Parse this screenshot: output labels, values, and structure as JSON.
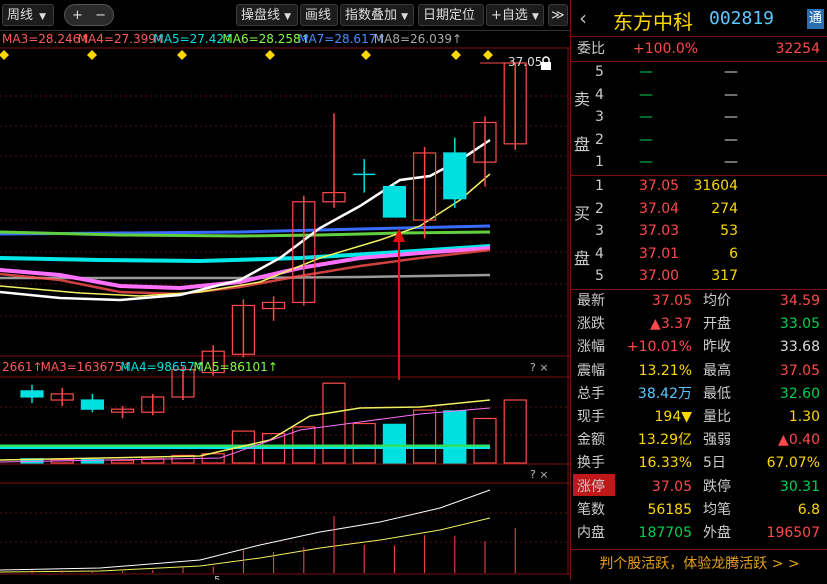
{
  "toolbar": {
    "period": "周线",
    "plus": "+",
    "minus": "−",
    "chart_mode": "操盘线",
    "draw": "画线",
    "index_overlay": "指数叠加",
    "date_locate": "日期定位",
    "watchlist": "+自选",
    "next": "≫"
  },
  "ma_legend": [
    {
      "text": "MA3=28.246↑",
      "color": "#ff5a5a"
    },
    {
      "text": "MA4=27.399↑",
      "color": "#ff5a5a"
    },
    {
      "text": "MA5=27.42↑",
      "color": "#00e0e0"
    },
    {
      "text": "MA6=28.258↑",
      "color": "#80ff40"
    },
    {
      "text": "MA7=28.617↑",
      "color": "#4a8cff"
    },
    {
      "text": "MA8=26.039↑",
      "color": "#aaaaaa"
    }
  ],
  "price_label": "37.05",
  "vol_legend": [
    {
      "text": "2661↑",
      "color": "#ff5a5a"
    },
    {
      "text": "MA3=163675↑",
      "color": "#ff5a5a"
    },
    {
      "text": "MA4=98657↑",
      "color": "#00e0e0"
    },
    {
      "text": "MA5=86101↑",
      "color": "#80ff40"
    }
  ],
  "panel_icons": "? ×",
  "x_tick": "5",
  "quote": {
    "name": "东方中科",
    "code": "002819",
    "tong": "通",
    "back": "‹",
    "weibi_label": "委比",
    "weibi_value": "+100.0%",
    "weibi_count": "32254",
    "sell_label_1": "卖",
    "sell_label_2": "盘",
    "buy_label_1": "买",
    "buy_label_2": "盘",
    "sells": [
      {
        "level": "5",
        "price": "—",
        "vol": "—"
      },
      {
        "level": "4",
        "price": "—",
        "vol": "—"
      },
      {
        "level": "3",
        "price": "—",
        "vol": "—"
      },
      {
        "level": "2",
        "price": "—",
        "vol": "—"
      },
      {
        "level": "1",
        "price": "—",
        "vol": "—"
      }
    ],
    "buys": [
      {
        "level": "1",
        "price": "37.05",
        "vol": "31604"
      },
      {
        "level": "2",
        "price": "37.04",
        "vol": "274"
      },
      {
        "level": "3",
        "price": "37.03",
        "vol": "53"
      },
      {
        "level": "4",
        "price": "37.01",
        "vol": "6"
      },
      {
        "level": "5",
        "price": "37.00",
        "vol": "317"
      }
    ],
    "stats": [
      {
        "l1": "最新",
        "v1": "37.05",
        "c1": "red",
        "l2": "均价",
        "v2": "34.59",
        "c2": "red"
      },
      {
        "l1": "涨跌",
        "v1": "▲3.37",
        "c1": "red",
        "l2": "开盘",
        "v2": "33.05",
        "c2": "green"
      },
      {
        "l1": "涨幅",
        "v1": "+10.01%",
        "c1": "red",
        "l2": "昨收",
        "v2": "33.68",
        "c2": "white"
      },
      {
        "l1": "震幅",
        "v1": "13.21%",
        "c1": "yellow",
        "l2": "最高",
        "v2": "37.05",
        "c2": "red"
      },
      {
        "l1": "总手",
        "v1": "38.42万",
        "c1": "cyan",
        "l2": "最低",
        "v2": "32.60",
        "c2": "green"
      },
      {
        "l1": "现手",
        "v1": "194▼",
        "c1": "yellow",
        "l2": "量比",
        "v2": "1.30",
        "c2": "yellow"
      },
      {
        "l1": "金额",
        "v1": "13.29亿",
        "c1": "yellow",
        "l2": "强弱",
        "v2": "▲0.40",
        "c2": "red"
      },
      {
        "l1": "换手",
        "v1": "16.33%",
        "c1": "yellow",
        "l2": "5日",
        "v2": "67.07%",
        "c2": "yellow"
      },
      {
        "l1": "涨停",
        "v1": "37.05",
        "c1": "red",
        "l2": "跌停",
        "v2": "30.31",
        "c2": "green"
      },
      {
        "l1": "笔数",
        "v1": "56185",
        "c1": "yellow",
        "l2": "均笔",
        "v2": "6.8",
        "c2": "yellow"
      },
      {
        "l1": "内盘",
        "v1": "187705",
        "c1": "green",
        "l2": "外盘",
        "v2": "196507",
        "c2": "red"
      }
    ],
    "promo": "判个股活跃，体验龙腾活跃 > >"
  },
  "colors": {
    "up": "#ff4a4a",
    "down": "#00e0e0",
    "grid": "#7a1010",
    "arrow": "#e01010"
  },
  "chart_data": {
    "type": "candlestick",
    "timeframe": "weekly",
    "y_axis_ticks_visible": [
      "37.05"
    ],
    "candles": [
      {
        "o": 26.3,
        "h": 26.5,
        "l": 25.9,
        "c": 26.1,
        "dir": "down"
      },
      {
        "o": 26.0,
        "h": 26.4,
        "l": 25.8,
        "c": 26.2,
        "dir": "up"
      },
      {
        "o": 26.0,
        "h": 26.2,
        "l": 25.6,
        "c": 25.7,
        "dir": "down"
      },
      {
        "o": 25.6,
        "h": 25.8,
        "l": 25.4,
        "c": 25.7,
        "dir": "up"
      },
      {
        "o": 25.6,
        "h": 26.2,
        "l": 25.5,
        "c": 26.1,
        "dir": "up"
      },
      {
        "o": 26.1,
        "h": 27.1,
        "l": 26.0,
        "c": 27.0,
        "dir": "up"
      },
      {
        "o": 26.9,
        "h": 27.8,
        "l": 26.8,
        "c": 27.6,
        "dir": "up"
      },
      {
        "o": 27.5,
        "h": 29.3,
        "l": 27.4,
        "c": 29.1,
        "dir": "up"
      },
      {
        "o": 29.0,
        "h": 29.4,
        "l": 28.6,
        "c": 29.2,
        "dir": "up"
      },
      {
        "o": 29.2,
        "h": 32.7,
        "l": 29.1,
        "c": 32.5,
        "dir": "up"
      },
      {
        "o": 32.5,
        "h": 35.4,
        "l": 32.3,
        "c": 32.8,
        "dir": "up"
      },
      {
        "o": 33.4,
        "h": 33.9,
        "l": 32.8,
        "c": 33.4,
        "dir": "doji"
      },
      {
        "o": 33.0,
        "h": 33.1,
        "l": 32.0,
        "c": 32.0,
        "dir": "down"
      },
      {
        "o": 31.9,
        "h": 34.3,
        "l": 31.3,
        "c": 34.1,
        "dir": "up"
      },
      {
        "o": 34.1,
        "h": 34.6,
        "l": 32.3,
        "c": 32.6,
        "dir": "down"
      },
      {
        "o": 33.8,
        "h": 35.3,
        "l": 33.0,
        "c": 35.1,
        "dir": "up"
      },
      {
        "o": 34.4,
        "h": 37.05,
        "l": 34.2,
        "c": 37.05,
        "dir": "up"
      }
    ],
    "volume": [
      5,
      4,
      4,
      3,
      5,
      9,
      11,
      38,
      35,
      43,
      95,
      47,
      46,
      63,
      62,
      53,
      75
    ],
    "volume_max": 100
  }
}
